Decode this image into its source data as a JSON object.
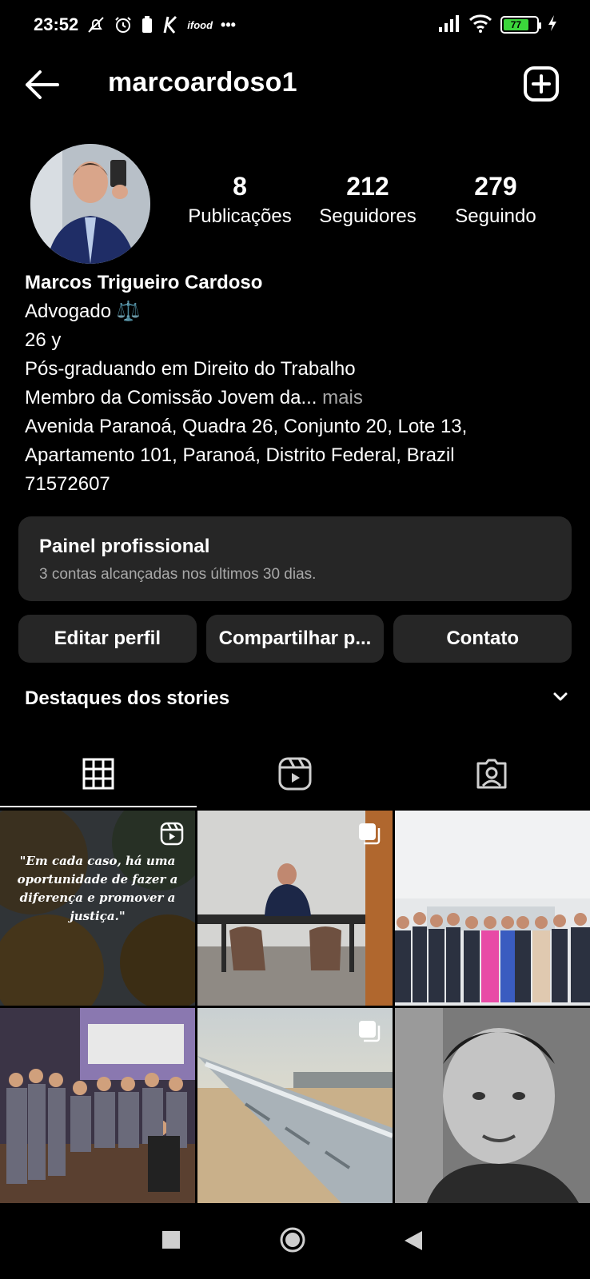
{
  "status_bar": {
    "time": "23:52",
    "carrier_text": "ifood",
    "more_dots": "•••",
    "battery_level": "77",
    "battery_fraction": 0.77
  },
  "header": {
    "username": "marcoardoso1"
  },
  "profile": {
    "stats": [
      {
        "value": "8",
        "label": "Publicações"
      },
      {
        "value": "212",
        "label": "Seguidores"
      },
      {
        "value": "279",
        "label": "Seguindo"
      }
    ],
    "bio": {
      "name": "Marcos Trigueiro Cardoso",
      "line1": "Advogado ⚖️",
      "line2": "26 y",
      "line3": "Pós-graduando em Direito do Trabalho",
      "line4": "Membro da Comissão Jovem da...",
      "more": " mais",
      "address1": "Avenida Paranoá, Quadra 26, Conjunto 20, Lote 13,",
      "address2": "Apartamento 101, Paranoá, Distrito Federal, Brazil",
      "postal": "71572607"
    }
  },
  "dashboard": {
    "title": "Painel profissional",
    "subtitle": "3 contas alcançadas nos últimos 30 dias."
  },
  "buttons": {
    "edit": "Editar perfil",
    "share": "Compartilhar p...",
    "contact": "Contato"
  },
  "highlights": {
    "title": "Destaques dos stories"
  },
  "posts": {
    "quote": "\"Em cada caso, há uma oportunidade de fazer a diferença e promover a justiça.\""
  },
  "colors": {
    "background": "#000000",
    "surface": "#262626",
    "muted_text": "#a8a8a8",
    "battery_green": "#3bd63b"
  }
}
